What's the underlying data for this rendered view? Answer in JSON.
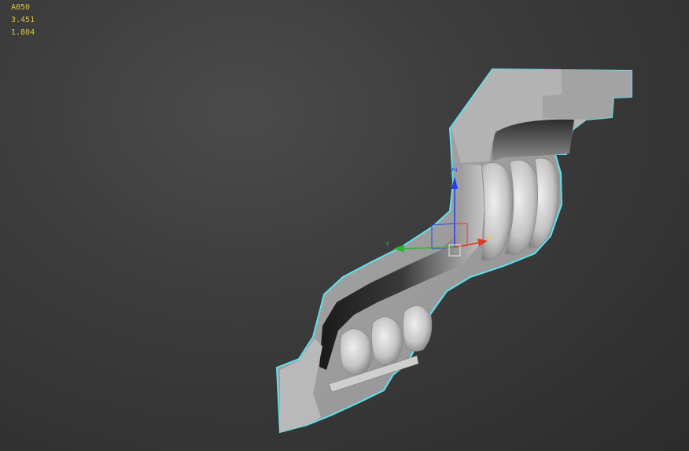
{
  "stats": {
    "object_name": "A050",
    "value_1": "3.451",
    "value_2": "1.804"
  },
  "gizmo": {
    "x_axis_label": "X",
    "y_axis_label": "Y",
    "z_axis_label": "Z",
    "x_color": "#e03a2a",
    "y_color": "#2fb536",
    "z_color": "#2a3fe0"
  },
  "selection_outline_color": "#5fe3ee",
  "icons": [
    "move-gizmo-icon"
  ]
}
